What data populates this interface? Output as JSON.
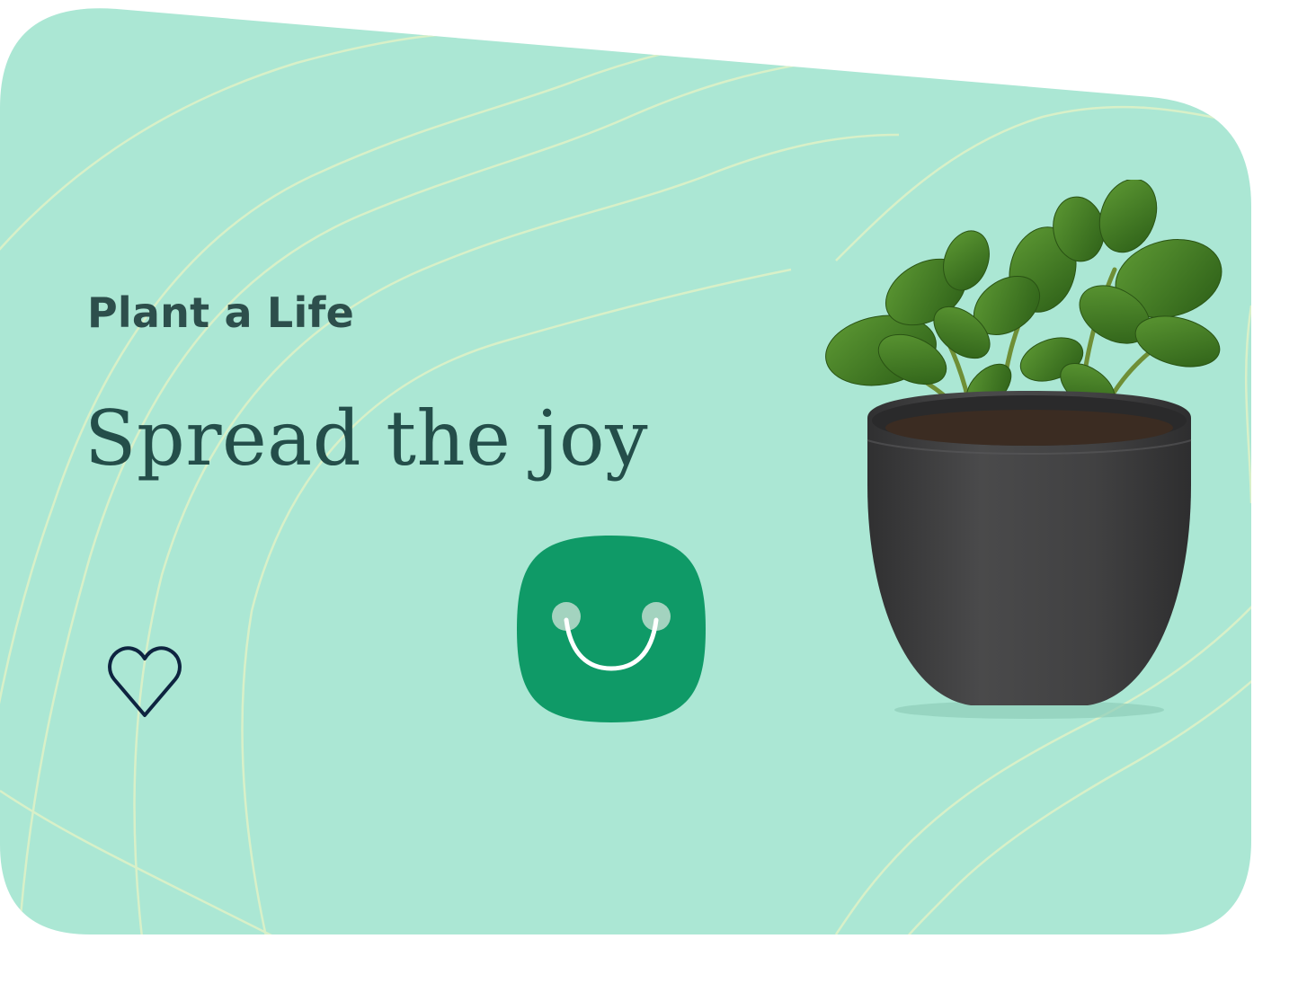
{
  "card": {
    "eyebrow": "Plant a Life",
    "headline": "Spread the joy",
    "background_color": "#abe7d4",
    "contour_line_color": "#d9f0c6"
  },
  "actions": {
    "favorite_icon": "heart-outline-icon",
    "favorite_icon_color": "#0e2440",
    "cart_icon": "smiling-bag-icon",
    "cart_icon_color": "#0f9a67"
  },
  "product": {
    "image": "potted-plant-image",
    "pot_color": "#3e3e3f",
    "leaf_color": "#3d7a22"
  }
}
